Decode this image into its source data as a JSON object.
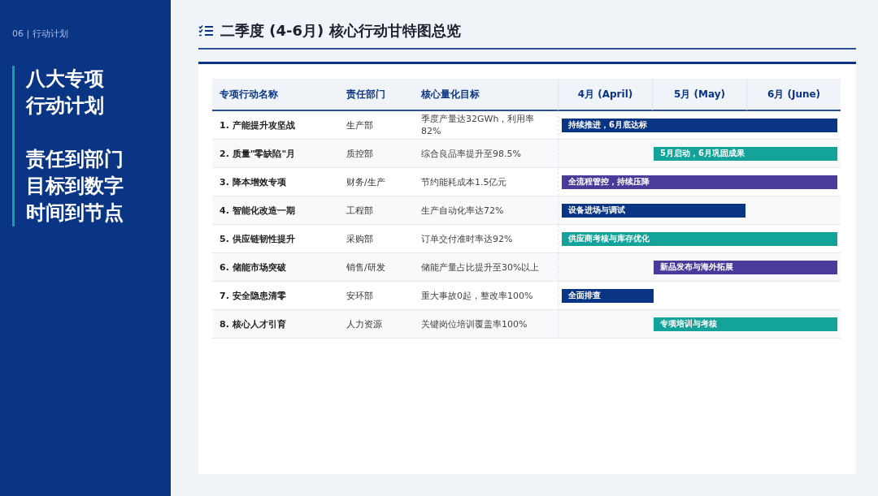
{
  "sidebar": {
    "section_label": "06 | 行动计划",
    "headline_lines": [
      "八大专项",
      "行动计划"
    ],
    "slogan_lines": [
      "责任到部门",
      "目标到数字",
      "时间到节点"
    ]
  },
  "title": "二季度 (4-6月) 核心行动甘特图总览",
  "table": {
    "columns": [
      "专项行动名称",
      "责任部门",
      "核心量化目标"
    ],
    "months": [
      "4月 (April)",
      "5月 (May)",
      "6月 (June)"
    ],
    "rows": [
      {
        "name": "1. 产能提升攻坚战",
        "dept": "生产部",
        "target": "季度产量达32GWh，利用率82%",
        "bar": {
          "label": "持续推进，6月底达标",
          "kind": "full",
          "color": "#0a3584"
        }
      },
      {
        "name": "2. 质量\"零缺陷\"月",
        "dept": "质控部",
        "target": "综合良品率提升至98.5%",
        "bar": {
          "label": "5月启动，6月巩固成果",
          "kind": "late",
          "color": "#13a39a"
        }
      },
      {
        "name": "3. 降本增效专项",
        "dept": "财务/生产",
        "target": "节约能耗成本1.5亿元",
        "bar": {
          "label": "全流程管控，持续压降",
          "kind": "full",
          "color": "#4a3a9a"
        }
      },
      {
        "name": "4. 智能化改造一期",
        "dept": "工程部",
        "target": "生产自动化率达72%",
        "bar": {
          "label": "设备进场与调试",
          "kind": "early",
          "color": "#0a3584"
        }
      },
      {
        "name": "5. 供应链韧性提升",
        "dept": "采购部",
        "target": "订单交付准时率达92%",
        "bar": {
          "label": "供应商考核与库存优化",
          "kind": "full",
          "color": "#13a39a"
        }
      },
      {
        "name": "6. 储能市场突破",
        "dept": "销售/研发",
        "target": "储能产量占比提升至30%以上",
        "bar": {
          "label": "新品发布与海外拓展",
          "kind": "late",
          "color": "#4a3a9a"
        }
      },
      {
        "name": "7. 安全隐患清零",
        "dept": "安环部",
        "target": "重大事故0起，整改率100%",
        "bar": {
          "label": "全面排查",
          "kind": "first",
          "color": "#0a3584"
        }
      },
      {
        "name": "8. 核心人才引育",
        "dept": "人力资源",
        "target": "关键岗位培训覆盖率100%",
        "bar": {
          "label": "专项培训与考核",
          "kind": "late",
          "color": "#13a39a"
        }
      }
    ]
  }
}
